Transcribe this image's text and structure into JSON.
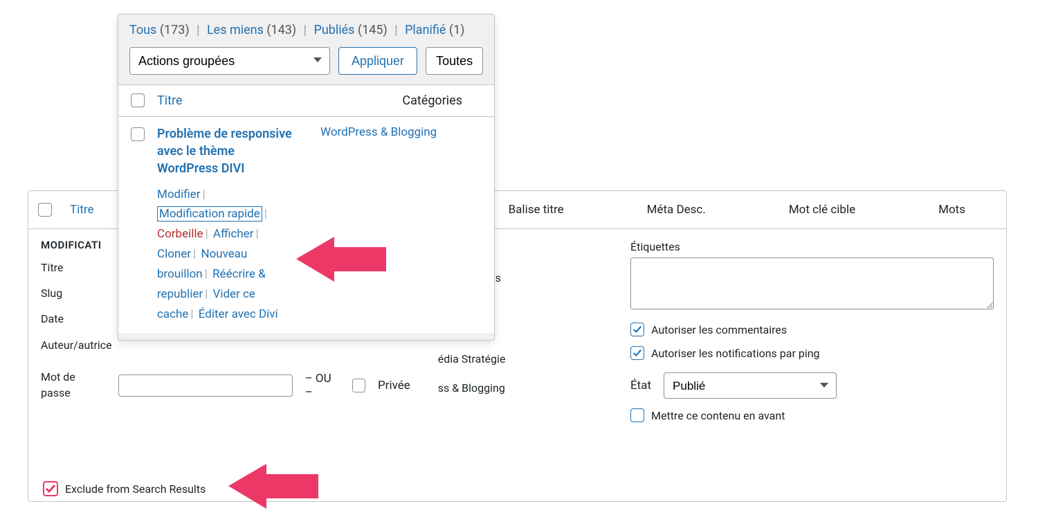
{
  "quick_edit": {
    "header": {
      "title_link": "Titre",
      "balise_titre": "Balise titre",
      "meta_desc": "Méta Desc.",
      "mot_cle_cible": "Mot clé cible",
      "mots": "Mots"
    },
    "section_title": "MODIFICATI",
    "fields": {
      "titre": "Titre",
      "slug": "Slug",
      "date": "Date",
      "auteur": "Auteur/autrice",
      "mot_de_passe": "Mot de passe",
      "ou": "– OU –",
      "privee": "Privée"
    },
    "middle": {
      "cat_business": "e & Business",
      "cat_strategie": "édia Stratégie",
      "cat_blogging": "ss & Blogging"
    },
    "right": {
      "etiquettes": "Étiquettes",
      "allow_comments": "Autoriser les commentaires",
      "allow_pings": "Autoriser les notifications par ping",
      "etat_label": "État",
      "etat_value": "Publié",
      "featured": "Mettre ce contenu en avant"
    },
    "exclude": "Exclude from Search Results"
  },
  "overlay": {
    "filters": {
      "all": "Tous",
      "all_count": "(173)",
      "mine": "Les miens",
      "mine_count": "(143)",
      "published": "Publiés",
      "published_count": "(145)",
      "scheduled": "Planifié",
      "scheduled_count": "(1)"
    },
    "bulk_actions": "Actions groupées",
    "apply": "Appliquer",
    "toutes": "Toutes",
    "thead": {
      "titre": "Titre",
      "categories": "Catégories"
    },
    "post": {
      "title": "Problème de responsive avec le thème WordPress DIVI",
      "category": "WordPress & Blogging",
      "actions": {
        "edit": "Modifier",
        "quick_edit": "Modification rapide",
        "trash": "Corbeille",
        "view": "Afficher",
        "clone": "Cloner",
        "new_draft": "Nouveau brouillon",
        "rewrite": "Réécrire & republier",
        "purge": "Vider ce cache",
        "edit_divi": "Éditer avec Divi"
      }
    }
  }
}
